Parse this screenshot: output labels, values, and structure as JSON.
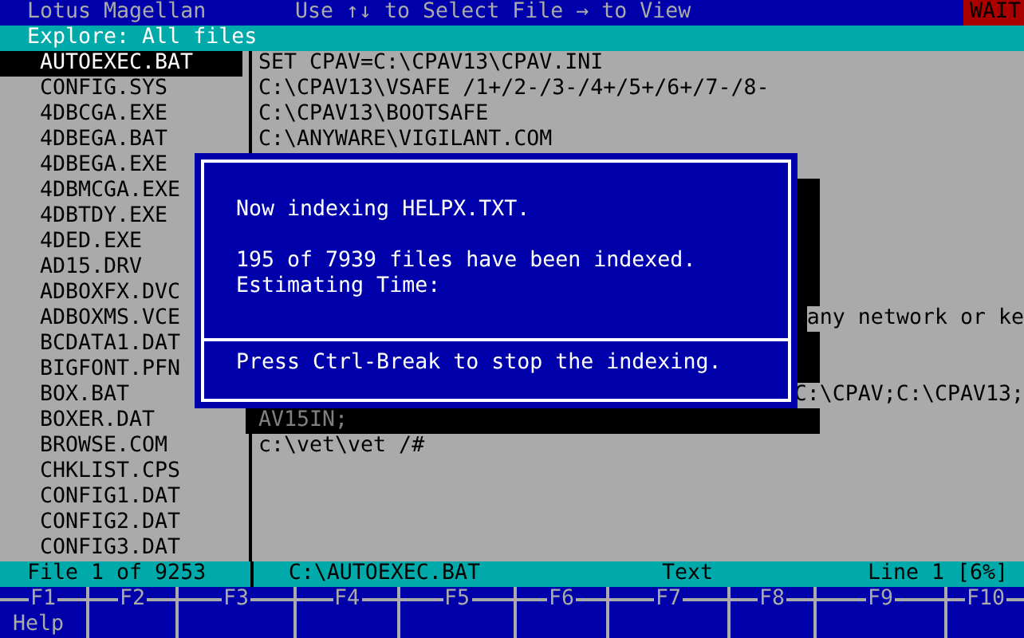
{
  "title_bar": {
    "app_title": "Lotus Magellan",
    "hint": "Use ↑↓ to Select File → to View",
    "status_badge": "WAIT"
  },
  "explore_bar": {
    "title": "Explore: All files"
  },
  "file_list": [
    {
      "name": "AUTOEXEC.BAT",
      "selected": true
    },
    {
      "name": "CONFIG.SYS",
      "selected": false
    },
    {
      "name": "4DBCGA.EXE",
      "selected": false
    },
    {
      "name": "4DBEGA.BAT",
      "selected": false
    },
    {
      "name": "4DBEGA.EXE",
      "selected": false
    },
    {
      "name": "4DBMCGA.EXE",
      "selected": false
    },
    {
      "name": "4DBTDY.EXE",
      "selected": false
    },
    {
      "name": "4DED.EXE",
      "selected": false
    },
    {
      "name": "AD15.DRV",
      "selected": false
    },
    {
      "name": "ADBOXFX.DVC",
      "selected": false
    },
    {
      "name": "ADBOXMS.VCE",
      "selected": false
    },
    {
      "name": "BCDATA1.DAT",
      "selected": false
    },
    {
      "name": "BIGFONT.PFN",
      "selected": false
    },
    {
      "name": "BOX.BAT",
      "selected": false
    },
    {
      "name": "BOXER.DAT",
      "selected": false
    },
    {
      "name": "BROWSE.COM",
      "selected": false
    },
    {
      "name": "CHKLIST.CPS",
      "selected": false
    },
    {
      "name": "CONFIG1.DAT",
      "selected": false
    },
    {
      "name": "CONFIG2.DAT",
      "selected": false
    },
    {
      "name": "CONFIG3.DAT",
      "selected": false
    }
  ],
  "viewer_lines": [
    {
      "text": "SET CPAV=C:\\CPAV13\\CPAV.INI",
      "kind": "text"
    },
    {
      "text": "C:\\CPAV13\\VSAFE /1+/2-/3-/4+/5+/6+/7-/8-",
      "kind": "text"
    },
    {
      "text": "C:\\CPAV13\\BOOTSAFE",
      "kind": "text"
    },
    {
      "text": "C:\\ANYWARE\\VIGILANT.COM",
      "kind": "text"
    },
    {
      "text": "any network or ke",
      "kind": "clipped"
    },
    {
      "text": "C:\\CPAV;C:\\CPAV13;",
      "kind": "clipped"
    },
    {
      "text": "AV15IN;",
      "kind": "shadowed"
    },
    {
      "text": "c:\\vet\\vet /#",
      "kind": "text"
    }
  ],
  "dialog": {
    "message": "Now indexing HELPX.TXT.",
    "progress": "195 of 7939 files have been indexed.",
    "estimate": "Estimating Time:",
    "footer": "Press Ctrl-Break to stop the indexing."
  },
  "status_bar": {
    "file_count": "File 1 of 9253",
    "path": "C:\\AUTOEXEC.BAT",
    "mode": "Text",
    "position": "Line 1 [6%]"
  },
  "function_keys": [
    {
      "key": "F1",
      "label": "Help"
    },
    {
      "key": "F2"
    },
    {
      "key": "F3"
    },
    {
      "key": "F4"
    },
    {
      "key": "F5"
    },
    {
      "key": "F6"
    },
    {
      "key": "F7"
    },
    {
      "key": "F8"
    },
    {
      "key": "F9"
    },
    {
      "key": "F10"
    }
  ]
}
